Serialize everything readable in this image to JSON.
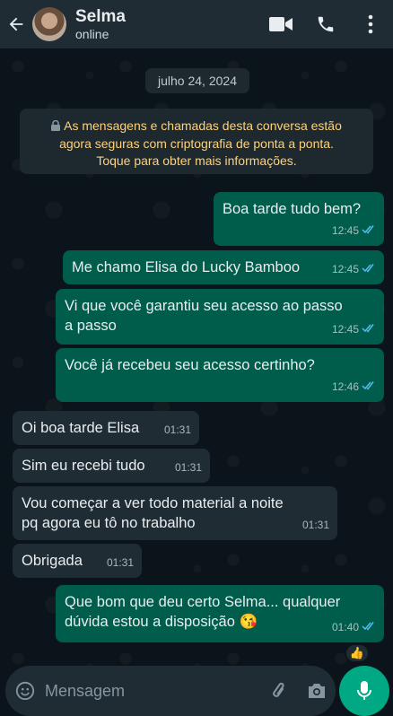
{
  "header": {
    "contact_name": "Selma",
    "contact_status": "online"
  },
  "chat": {
    "date_chip": "julho 24, 2024",
    "encryption_notice_line1": "As mensagens e chamadas desta conversa estão",
    "encryption_notice_line2": "agora seguras com criptografia de ponta a ponta.",
    "encryption_notice_line3": "Toque para obter mais informações.",
    "messages": [
      {
        "dir": "out",
        "lines": [
          "Boa tarde tudo bem?"
        ],
        "time": "12:45",
        "read": true
      },
      {
        "dir": "out",
        "lines": [
          "Me chamo Elisa do Lucky Bamboo"
        ],
        "time": "12:45",
        "read": true
      },
      {
        "dir": "out",
        "lines": [
          "Vi que você garantiu seu acesso ao passo",
          "a passo"
        ],
        "time": "12:45",
        "read": true
      },
      {
        "dir": "out",
        "lines": [
          "Você já recebeu seu acesso certinho?"
        ],
        "time": "12:46",
        "read": true
      },
      {
        "dir": "in",
        "lines": [
          "Oi boa tarde Elisa"
        ],
        "time": "01:31"
      },
      {
        "dir": "in",
        "lines": [
          "Sim eu recebi tudo"
        ],
        "time": "01:31"
      },
      {
        "dir": "in",
        "lines": [
          "Vou começar a ver todo material a noite",
          "pq agora eu tô no trabalho"
        ],
        "time": "01:31"
      },
      {
        "dir": "in",
        "lines": [
          "Obrigada"
        ],
        "time": "01:31"
      },
      {
        "dir": "out",
        "lines": [
          "Que bom que deu certo Selma... qualquer",
          "dúvida estou a disposição 😘"
        ],
        "time": "01:40",
        "read": true
      }
    ],
    "reaction": "👍"
  },
  "composer": {
    "placeholder": "Mensagem"
  },
  "colors": {
    "outgoing_bubble": "#005c4b",
    "incoming_bubble": "#202c33",
    "accent": "#00a884",
    "read_tick": "#53bdeb"
  },
  "icons": [
    "back-arrow-icon",
    "video-call-icon",
    "phone-call-icon",
    "more-options-icon",
    "lock-icon",
    "read-receipt-icon",
    "emoji-icon",
    "attach-icon",
    "camera-icon",
    "mic-icon"
  ]
}
